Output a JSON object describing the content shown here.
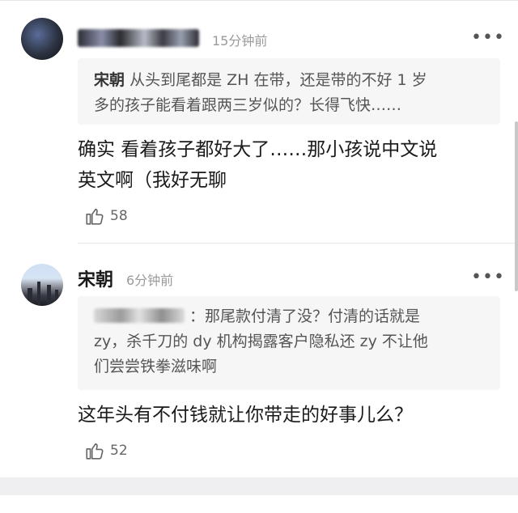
{
  "comments": [
    {
      "time": "15分钟前",
      "more_icon": "•••",
      "quote": {
        "name": "宋朝",
        "text_line1": "从头到尾都是 ZH 在带，还是带的不好 1 岁",
        "text_line2": "多的孩子能看着跟两三岁似的？长得飞快……"
      },
      "body_line1": "确实 看着孩子都好大了……那小孩说中文说",
      "body_line2": "英文啊（我好无聊",
      "likes": "58"
    },
    {
      "name": "宋朝",
      "time": "6分钟前",
      "more_icon": "•••",
      "quote": {
        "text_line1": "：那尾款付清了没？付清的话就是",
        "text_line2": "zy，杀千刀的 dy 机构揭露客户隐私还 zy 不让他",
        "text_line3": "们尝尝铁拳滋味啊"
      },
      "body_line1": "这年头有不付钱就让你带走的好事儿么？",
      "likes": "52"
    }
  ],
  "icons": {
    "more": "more-dots-icon",
    "like": "thumbs-up-icon"
  },
  "colors": {
    "background": "#ffffff",
    "quote_bg": "#f6f6f6",
    "muted": "#9a9a9a"
  }
}
